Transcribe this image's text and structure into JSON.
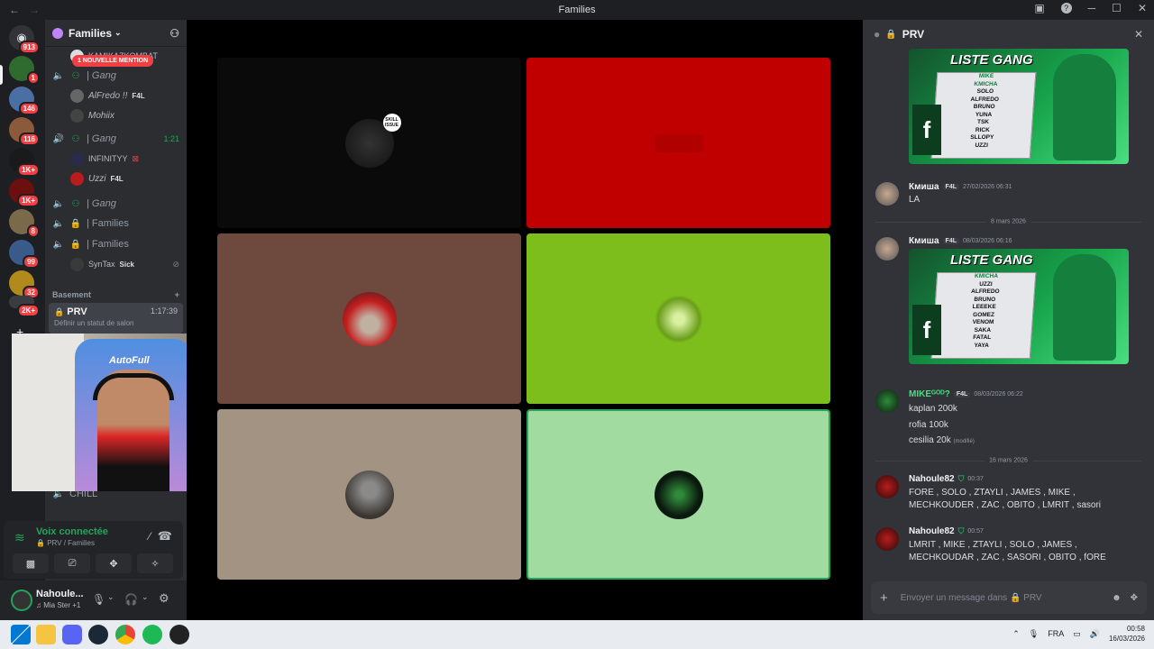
{
  "window": {
    "title": "Families"
  },
  "server_rail": {
    "badges": [
      "913",
      "1",
      "146",
      "116",
      "1K+",
      "1K+",
      "8",
      "99",
      "32",
      "2K+"
    ]
  },
  "sidebar": {
    "server_name": "Families",
    "mention_pill": "1 NOUVELLE MENTION",
    "top_user": "KAMIKAZKOMBAT",
    "channels": [
      {
        "name": "| Gang",
        "users": [
          {
            "name": "AlFredo !!",
            "tag": "F4L"
          },
          {
            "name": "Mohiix",
            "tag": ""
          }
        ]
      },
      {
        "name": "| Gang",
        "time": "1:21",
        "users": [
          {
            "name": "INFINITYY",
            "tag": ""
          },
          {
            "name": "Uzzi",
            "tag": "F4L"
          }
        ]
      },
      {
        "name": "| Gang"
      },
      {
        "name": "| Families"
      },
      {
        "name": "| Families",
        "users": [
          {
            "name": "SynTax",
            "tag": "Sick"
          }
        ]
      }
    ],
    "category": "Basement",
    "active_channel": {
      "name": "PRV",
      "time": "1:17:39",
      "status": "Définir un statut de salon"
    },
    "chill_channel": "CHILL",
    "webcam_label": "AutoFull"
  },
  "voice": {
    "status": "Voix connectée",
    "location": "PRV / Families"
  },
  "user_panel": {
    "name": "Nahoule...",
    "status": "Mia Ster +1"
  },
  "chat": {
    "channel": "PRV",
    "messages": [
      {
        "author": "Кмиша",
        "tag": "F4L",
        "time": "27/02/2026 06:31",
        "lines": [
          "LA"
        ]
      },
      {
        "author": "Кмиша",
        "tag": "F4L",
        "time": "08/03/2026 06:16",
        "lines": []
      },
      {
        "author": "MIKEᴳᴼᴰ?",
        "tag": "F4L",
        "time": "08/03/2026 06:22",
        "lines": [
          "kaplan 200k",
          "rofia 100k",
          "cesilia 20k"
        ],
        "edited": "(modifié)"
      },
      {
        "author": "Nahoule82",
        "tag": "",
        "time": "00:37",
        "lines": [
          "FORE , SOLO , ZTAYLI , JAMES , MIKE ,",
          "MECHKOUDER , ZAC , OBITO , LMRIT , sasori"
        ]
      },
      {
        "author": "Nahoule82",
        "tag": "",
        "time": "00:57",
        "lines": [
          "LMRIT , MIKE , ZTAYLI , SOLO , JAMES ,",
          "MECHKOUDAR , ZAC , SASORI , OBITO , fORE"
        ]
      }
    ],
    "dividers": [
      "8 mars 2026",
      "16 mars 2026"
    ],
    "images": [
      {
        "title": "LISTE GANG",
        "names": [
          "MIKE",
          "KMICHA",
          "SOLO",
          "ALFREDO",
          "BRUNO",
          "YUNA",
          "TSK",
          "RICK",
          "SLLOPY",
          "UZZI"
        ]
      },
      {
        "title": "LISTE GANG",
        "names": [
          "KMICHA",
          "UZZI",
          "ALFREDO",
          "BRUNO",
          "LEEEKE",
          "GOMEZ",
          "VENOM",
          "SAKA",
          "FATAL",
          "YAYA"
        ]
      }
    ],
    "composer_placeholder": "Envoyer un message dans",
    "composer_channel": "PRV"
  },
  "stage": {
    "tile_colors": [
      "#0a0a0a",
      "#c00000",
      "#6e4a3e",
      "#7ebe1c",
      "#a39382",
      "#a1dba0"
    ],
    "tile_labels": [
      "SKILL ISSUE",
      "",
      "",
      "",
      "",
      ""
    ]
  },
  "taskbar": {
    "language": "FRA",
    "time": "00:58",
    "date": "16/03/2026"
  }
}
